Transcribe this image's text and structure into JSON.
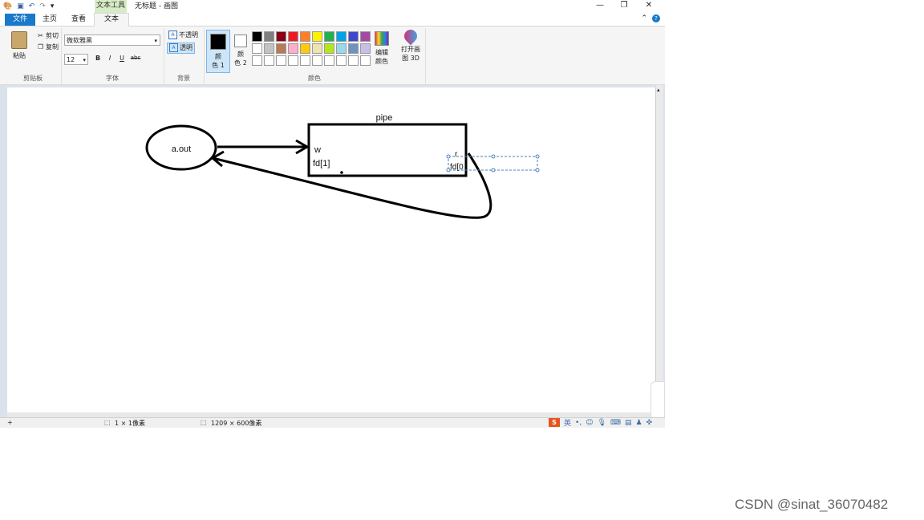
{
  "window": {
    "context_tab": "文本工具",
    "title": "无标题 - 画图",
    "minimize_icon": "minimize-icon",
    "restore_icon": "restore-icon",
    "close_icon": "close-icon"
  },
  "tabs": [
    {
      "label": "文件"
    },
    {
      "label": "主页"
    },
    {
      "label": "查看"
    },
    {
      "label": "文本"
    }
  ],
  "ribbon": {
    "clipboard": {
      "paste": "粘贴",
      "cut": "剪切",
      "copy": "复制",
      "group": "剪贴板"
    },
    "font": {
      "family": "微软雅黑",
      "size": "12",
      "bold": "B",
      "italic": "I",
      "underline": "U",
      "strike": "abc",
      "group": "字体"
    },
    "background": {
      "opaque": "不透明",
      "transparent": "透明",
      "group": "背景"
    },
    "colors": {
      "color1_a": "颜",
      "color1_b": "色 1",
      "color2_a": "颜",
      "color2_b": "色 2",
      "edit_a": "编辑",
      "edit_b": "颜色",
      "paint3d_a": "打开画",
      "paint3d_b": "图 3D",
      "group": "颜色",
      "color1": "#000000",
      "color2": "#ffffff",
      "palette": [
        "#000000",
        "#7f7f7f",
        "#880015",
        "#ed1c24",
        "#ff7f27",
        "#fff200",
        "#22b14c",
        "#00a2e8",
        "#3f48cc",
        "#a349a4",
        "#ffffff",
        "#c3c3c3",
        "#b97a57",
        "#ffaec9",
        "#ffc90e",
        "#efe4b0",
        "#b5e61d",
        "#99d9ea",
        "#7092be",
        "#c8bfe7",
        "#ffffff",
        "#ffffff",
        "#ffffff",
        "#ffffff",
        "#ffffff",
        "#ffffff",
        "#ffffff",
        "#ffffff",
        "#ffffff",
        "#ffffff"
      ]
    }
  },
  "diagram": {
    "process_label": "a.out",
    "pipe_label": "pipe",
    "write_end": "w",
    "write_fd": "fd[1]",
    "read_end": "r",
    "read_fd": "fd[0"
  },
  "status": {
    "cursor_pos": "1 × 1像素",
    "canvas_size": "1209 × 600像素"
  },
  "watermark": "CSDN @sinat_36070482"
}
